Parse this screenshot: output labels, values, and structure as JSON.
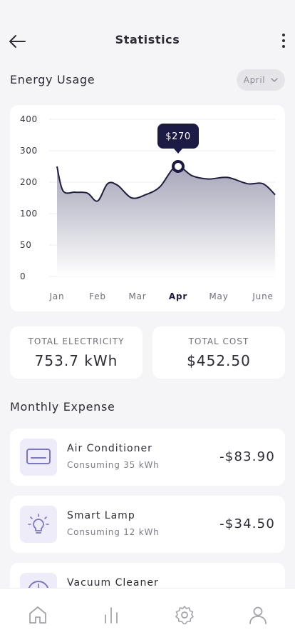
{
  "header": {
    "title": "Statistics",
    "back_icon": "arrow-left-icon",
    "menu_icon": "more-vertical-icon"
  },
  "energy": {
    "title": "Energy Usage",
    "month_selected": "April"
  },
  "chart_data": {
    "type": "area",
    "x_labels": [
      "Jan",
      "Feb",
      "Mar",
      "Apr",
      "May",
      "June"
    ],
    "selected_label": "Apr",
    "y_ticks": [
      400,
      300,
      200,
      100,
      50,
      0
    ],
    "x": [
      0,
      0.15,
      0.45,
      0.75,
      1,
      1.25,
      1.5,
      1.85,
      2.2,
      2.55,
      2.95,
      3.35,
      3.75,
      4.2,
      4.65,
      5,
      5.3
    ],
    "values": [
      250,
      172,
      168,
      165,
      140,
      195,
      190,
      150,
      160,
      185,
      250,
      220,
      210,
      215,
      195,
      195,
      160
    ],
    "tooltip": {
      "x": 3.0,
      "value": 250,
      "label": "$270"
    },
    "ylim": [
      0,
      400
    ],
    "grid": true,
    "colors": {
      "line": "#1f1d40",
      "fill_top": "#a2a2b6",
      "fill_bottom": "#ffffff",
      "tooltip_bg": "#1c1b45"
    }
  },
  "totals": {
    "electricity_label": "TOTAL ELECTRICITY",
    "electricity_value": "753.7 kWh",
    "cost_label": "TOTAL COST",
    "cost_value": "$452.50"
  },
  "monthly": {
    "title": "Monthly Expense",
    "items": [
      {
        "name": "Air Conditioner",
        "sub": "Consuming 35 kWh",
        "amount": "-$83.90",
        "icon": "air-conditioner-icon"
      },
      {
        "name": "Smart Lamp",
        "sub": "Consuming 12 kWh",
        "amount": "-$34.50",
        "icon": "lamp-icon"
      },
      {
        "name": "Vacuum Cleaner",
        "sub": "",
        "amount": "",
        "icon": "vacuum-icon"
      }
    ]
  },
  "nav": {
    "items": [
      "home-icon",
      "stats-icon",
      "settings-icon",
      "profile-icon"
    ],
    "active_color": "#8a8a96"
  }
}
